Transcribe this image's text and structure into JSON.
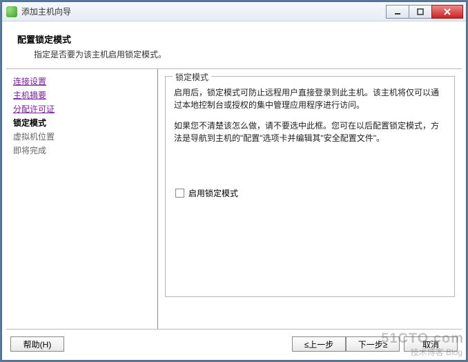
{
  "window": {
    "title": "添加主机向导"
  },
  "header": {
    "title": "配置锁定模式",
    "subtitle": "指定是否要为该主机启用锁定模式。"
  },
  "sidebar": {
    "steps": [
      {
        "label": "连接设置",
        "state": "visited"
      },
      {
        "label": "主机摘要",
        "state": "visited"
      },
      {
        "label": "分配许可证",
        "state": "visited"
      },
      {
        "label": "锁定模式",
        "state": "current"
      },
      {
        "label": "虚拟机位置",
        "state": "upcoming"
      },
      {
        "label": "即将完成",
        "state": "upcoming"
      }
    ]
  },
  "content": {
    "group_title": "锁定模式",
    "para1": "启用后，锁定模式可防止远程用户直接登录到此主机。该主机将仅可以通过本地控制台或授权的集中管理应用程序进行访问。",
    "para2": "如果您不清楚该怎么做，请不要选中此框。您可在以后配置锁定模式，方法是导航到主机的\"配置\"选项卡并编辑其\"安全配置文件\"。",
    "checkbox_label": "启用锁定模式",
    "checkbox_checked": false
  },
  "footer": {
    "help": "帮助(H)",
    "back": "≤上一步",
    "next": "下一步≥",
    "cancel": "取消"
  },
  "watermark": {
    "line1": "51CTO.com",
    "line2": "技术博客 Blog"
  }
}
